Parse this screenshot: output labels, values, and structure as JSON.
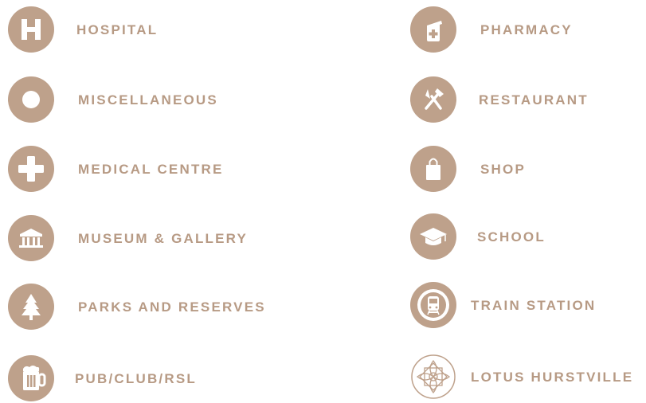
{
  "accent_color": "#bea18b",
  "legend": {
    "left": [
      {
        "label": "HOSPITAL",
        "icon": "hospital-icon"
      },
      {
        "label": "MISCELLANEOUS",
        "icon": "miscellaneous-icon"
      },
      {
        "label": "MEDICAL CENTRE",
        "icon": "medical-cross-icon"
      },
      {
        "label": "MUSEUM & GALLERY",
        "icon": "museum-icon"
      },
      {
        "label": "PARKS AND RESERVES",
        "icon": "tree-icon"
      },
      {
        "label": "PUB/CLUB/RSL",
        "icon": "beer-mug-icon"
      }
    ],
    "right": [
      {
        "label": "PHARMACY",
        "icon": "pharmacy-icon"
      },
      {
        "label": "RESTAURANT",
        "icon": "restaurant-icon"
      },
      {
        "label": "SHOP",
        "icon": "shopping-bag-icon"
      },
      {
        "label": "SCHOOL",
        "icon": "graduation-cap-icon"
      },
      {
        "label": "TRAIN STATION",
        "icon": "train-icon"
      },
      {
        "label": "LOTUS HURSTVILLE",
        "icon": "lotus-logo-icon"
      }
    ]
  }
}
